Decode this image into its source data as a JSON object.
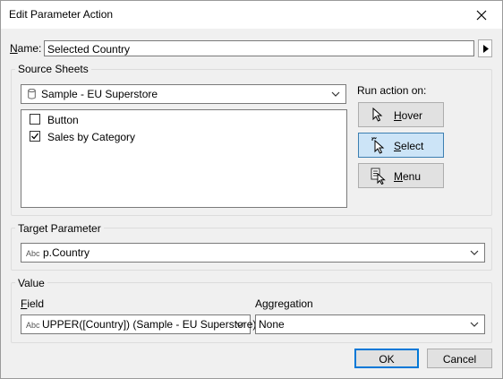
{
  "window": {
    "title": "Edit Parameter Action"
  },
  "name_field": {
    "label_underlined": "N",
    "label_rest": "ame:",
    "value": "Selected Country"
  },
  "source_sheets": {
    "title": "Source Sheets",
    "datasource": "Sample - EU Superstore",
    "sheets": [
      {
        "label": "Button",
        "checked": false
      },
      {
        "label": "Sales by Category",
        "checked": true
      }
    ]
  },
  "run_action": {
    "title": "Run action on:",
    "hover": {
      "underlined": "H",
      "rest": "over"
    },
    "select": {
      "underlined": "S",
      "rest": "elect",
      "selected": true
    },
    "menu": {
      "underlined": "M",
      "rest": "enu"
    }
  },
  "target_parameter": {
    "title": "Target Parameter",
    "type_badge": "Abc",
    "value": "p.Country"
  },
  "value_group": {
    "title": "Value",
    "field_label_underlined": "F",
    "field_label_rest": "ield",
    "field_type_badge": "Abc",
    "field_value": "UPPER([Country]) (Sample - EU Superstore)",
    "aggregation_label": "Aggregation",
    "aggregation_value": "None"
  },
  "footer": {
    "ok": "OK",
    "cancel": "Cancel"
  }
}
